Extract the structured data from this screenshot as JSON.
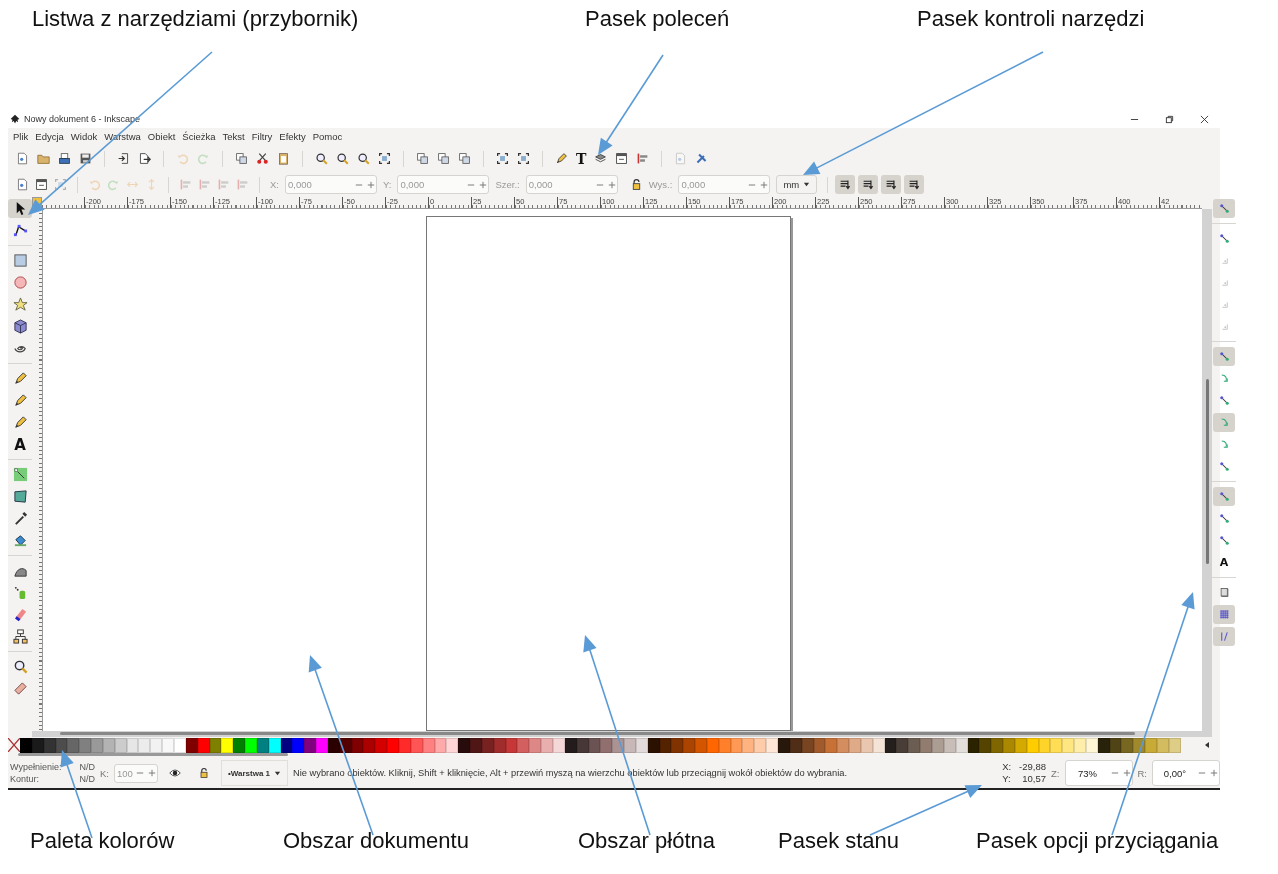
{
  "annotations_top": [
    {
      "text": "Listwa z narzędziami (przybornik)"
    },
    {
      "text": "Pasek poleceń"
    },
    {
      "text": "Pasek kontroli narzędzi"
    }
  ],
  "window": {
    "title": "Nowy dokument 6 - Inkscape"
  },
  "menu": [
    "Plik",
    "Edycja",
    "Widok",
    "Warstwa",
    "Obiekt",
    "Ścieżka",
    "Tekst",
    "Filtry",
    "Efekty",
    "Pomoc"
  ],
  "commands_bar": [
    [
      {
        "disabled": false
      },
      {
        "disabled": false
      },
      {
        "disabled": false
      },
      {
        "disabled": false
      }
    ],
    [
      {
        "disabled": false
      },
      {
        "disabled": false
      }
    ],
    [
      {
        "disabled": true
      },
      {
        "disabled": true
      }
    ],
    [
      {
        "disabled": false
      },
      {
        "disabled": false
      },
      {
        "disabled": false
      }
    ],
    [
      {
        "disabled": false
      },
      {
        "disabled": false
      },
      {
        "disabled": false
      },
      {
        "disabled": false
      }
    ],
    [
      {
        "disabled": false
      },
      {
        "disabled": false
      },
      {
        "disabled": false
      }
    ],
    [
      {
        "disabled": false
      },
      {
        "disabled": false
      }
    ],
    [
      {
        "disabled": false
      },
      {
        "disabled": false,
        "glyph": "T"
      },
      {
        "disabled": false
      },
      {
        "disabled": false
      },
      {
        "disabled": false
      }
    ],
    [
      {
        "disabled": true
      },
      {
        "disabled": false
      }
    ]
  ],
  "tool_controls": {
    "buttons": [
      [
        {
          "disabled": false
        },
        {
          "disabled": false
        },
        {
          "disabled": true
        }
      ],
      [
        {
          "disabled": true
        },
        {
          "disabled": true
        },
        {
          "disabled": true
        },
        {
          "disabled": true
        }
      ],
      [
        {
          "disabled": true
        },
        {
          "disabled": true
        },
        {
          "disabled": true
        },
        {
          "disabled": true
        }
      ]
    ],
    "fields": [
      {
        "label": "X:",
        "value": "0,000",
        "disabled": true
      },
      {
        "label": "Y:",
        "value": "0,000",
        "disabled": true
      },
      {
        "label": "Szer.:",
        "value": "0,000",
        "disabled": true
      },
      {
        "label": "Wys.:",
        "value": "0,000",
        "disabled": true
      }
    ],
    "unit": "mm",
    "mode_buttons": [
      {
        "on": true
      },
      {
        "on": true
      },
      {
        "on": true
      },
      {
        "on": true
      }
    ]
  },
  "ruler_labels": [
    "-200",
    "-175",
    "-150",
    "-125",
    "-100",
    "-75",
    "-50",
    "-25",
    "0",
    "25",
    "50",
    "75",
    "100",
    "125",
    "150",
    "175",
    "200",
    "225",
    "250",
    "275",
    "300",
    "325",
    "350",
    "375",
    "400",
    "42"
  ],
  "toolbox": [
    [
      {
        "selected": true
      },
      {
        "selected": false
      }
    ],
    [
      {
        "selected": false
      },
      {
        "selected": false
      },
      {
        "selected": false
      },
      {
        "selected": false
      },
      {
        "selected": false
      }
    ],
    [
      {
        "selected": false
      },
      {
        "selected": false
      },
      {
        "selected": false
      },
      {
        "selected": false,
        "glyph": "A"
      }
    ],
    [
      {
        "selected": false
      },
      {
        "selected": false
      },
      {
        "selected": false
      },
      {
        "selected": false
      }
    ],
    [
      {
        "selected": false
      },
      {
        "selected": false
      },
      {
        "selected": false
      },
      {
        "selected": false
      }
    ],
    [
      {
        "selected": false
      },
      {
        "selected": false
      }
    ]
  ],
  "snap_bar": [
    [
      {
        "on": true,
        "disabled": false
      }
    ],
    [
      {
        "on": false,
        "disabled": false
      },
      {
        "on": false,
        "disabled": true
      },
      {
        "on": false,
        "disabled": true
      },
      {
        "on": false,
        "disabled": true
      },
      {
        "on": false,
        "disabled": true
      }
    ],
    [
      {
        "on": true,
        "disabled": false
      },
      {
        "on": false,
        "disabled": false
      },
      {
        "on": false,
        "disabled": false
      },
      {
        "on": true,
        "disabled": false
      },
      {
        "on": false,
        "disabled": false
      },
      {
        "on": false,
        "disabled": false
      }
    ],
    [
      {
        "on": true,
        "disabled": false
      },
      {
        "on": false,
        "disabled": false
      },
      {
        "on": false,
        "disabled": false
      },
      {
        "on": false,
        "disabled": false,
        "glyph": "A"
      }
    ],
    [
      {
        "on": false,
        "disabled": false
      },
      {
        "on": true,
        "disabled": false
      },
      {
        "on": true,
        "disabled": false
      }
    ]
  ],
  "palette": [
    {
      "color": "#000000"
    },
    {
      "color": "#1a1a1a"
    },
    {
      "color": "#333333"
    },
    {
      "color": "#4d4d4d"
    },
    {
      "color": "#666666"
    },
    {
      "color": "#808080"
    },
    {
      "color": "#999999"
    },
    {
      "color": "#b3b3b3"
    },
    {
      "color": "#cccccc"
    },
    {
      "color": "#e6e6e6"
    },
    {
      "color": "#ececec"
    },
    {
      "color": "#f2f2f2"
    },
    {
      "color": "#f8f8f8"
    },
    {
      "color": "#ffffff"
    },
    {
      "color": "#800000"
    },
    {
      "color": "#ff0000"
    },
    {
      "color": "#808000"
    },
    {
      "color": "#ffff00"
    },
    {
      "color": "#008000"
    },
    {
      "color": "#00ff00"
    },
    {
      "color": "#008080"
    },
    {
      "color": "#00ffff"
    },
    {
      "color": "#000080"
    },
    {
      "color": "#0000ff"
    },
    {
      "color": "#800080"
    },
    {
      "color": "#ff00ff"
    },
    {
      "color": "#2b0000"
    },
    {
      "color": "#550000"
    },
    {
      "color": "#800001"
    },
    {
      "color": "#aa0000"
    },
    {
      "color": "#d40000"
    },
    {
      "color": "#ff0001"
    },
    {
      "color": "#ff2a2a"
    },
    {
      "color": "#ff5555"
    },
    {
      "color": "#ff8080"
    },
    {
      "color": "#ffaaaa"
    },
    {
      "color": "#ffd5d5"
    },
    {
      "color": "#280b0b"
    },
    {
      "color": "#501616"
    },
    {
      "color": "#782121"
    },
    {
      "color": "#a02c2c"
    },
    {
      "color": "#c83737"
    },
    {
      "color": "#d35f5f"
    },
    {
      "color": "#de8787"
    },
    {
      "color": "#e9afaf"
    },
    {
      "color": "#f4d7d7"
    },
    {
      "color": "#241c1c"
    },
    {
      "color": "#483737"
    },
    {
      "color": "#6c5353"
    },
    {
      "color": "#916f6f"
    },
    {
      "color": "#ac9393"
    },
    {
      "color": "#c8b7b7"
    },
    {
      "color": "#e3dbdb"
    },
    {
      "color": "#2b1100"
    },
    {
      "color": "#552200"
    },
    {
      "color": "#803300"
    },
    {
      "color": "#aa4400"
    },
    {
      "color": "#d45500"
    },
    {
      "color": "#ff6600"
    },
    {
      "color": "#ff7f2a"
    },
    {
      "color": "#ff9955"
    },
    {
      "color": "#ffb380"
    },
    {
      "color": "#ffccaa"
    },
    {
      "color": "#ffe6d5"
    },
    {
      "color": "#28170b"
    },
    {
      "color": "#502d16"
    },
    {
      "color": "#784421"
    },
    {
      "color": "#a05a2c"
    },
    {
      "color": "#c87137"
    },
    {
      "color": "#d38d5f"
    },
    {
      "color": "#deaa87"
    },
    {
      "color": "#e9c6af"
    },
    {
      "color": "#f4e3d7"
    },
    {
      "color": "#241f1c"
    },
    {
      "color": "#483e37"
    },
    {
      "color": "#6c5d53"
    },
    {
      "color": "#917c6f"
    },
    {
      "color": "#ac9d93"
    },
    {
      "color": "#c8beb7"
    },
    {
      "color": "#e3dedb"
    },
    {
      "color": "#2b2200"
    },
    {
      "color": "#554400"
    },
    {
      "color": "#806600"
    },
    {
      "color": "#aa8800"
    },
    {
      "color": "#d4aa00"
    },
    {
      "color": "#ffcc00"
    },
    {
      "color": "#ffd42a"
    },
    {
      "color": "#ffdd55"
    },
    {
      "color": "#ffe680"
    },
    {
      "color": "#ffeeaa"
    },
    {
      "color": "#fff6d5"
    },
    {
      "color": "#28220b"
    },
    {
      "color": "#504416"
    },
    {
      "color": "#786721"
    },
    {
      "color": "#a0892c"
    },
    {
      "color": "#c8ab37"
    },
    {
      "color": "#d3bc5f"
    },
    {
      "color": "#decd87"
    }
  ],
  "status_bar": {
    "fill_label": "Wypełnienie:",
    "fill_value": "N/D",
    "stroke_label": "Kontur:",
    "stroke_value": "N/D",
    "opacity_label": "K:",
    "opacity_value": "100",
    "layer": "•Warstwa 1",
    "message": "Nie wybrano obiektów. Kliknij, Shift + kliknięcie, Alt + przewiń myszą na wierzchu obiektów lub przeciągnij wokół obiektów do wybrania.",
    "x_label": "X:",
    "x_value": "-29,88",
    "y_label": "Y:",
    "y_value": "10,57",
    "zoom_label": "Z:",
    "zoom_value": "73%",
    "rotation_label": "R:",
    "rotation_value": "0,00°"
  },
  "annotations_bottom": [
    {
      "text": "Paleta kolorów"
    },
    {
      "text": "Obszar dokumentu"
    },
    {
      "text": "Obszar płótna"
    },
    {
      "text": "Pasek stanu"
    },
    {
      "text": "Pasek opcji przyciągania"
    }
  ]
}
